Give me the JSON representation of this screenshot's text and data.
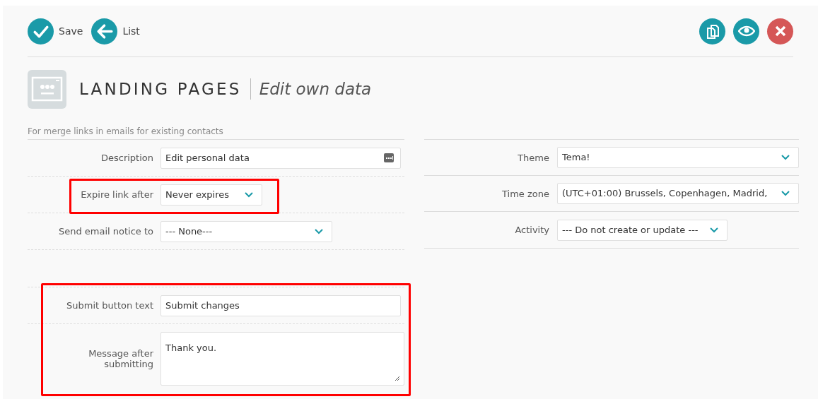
{
  "toolbar": {
    "left": [
      {
        "kind": "check",
        "label": "Save"
      },
      {
        "kind": "back",
        "label": "List"
      }
    ],
    "right": [
      {
        "kind": "copy",
        "color": "#1a9aa8"
      },
      {
        "kind": "view",
        "color": "#1a9aa8"
      },
      {
        "kind": "close",
        "color": "#d55757"
      }
    ]
  },
  "header": {
    "title": "LANDING PAGES",
    "subtitle": "Edit own data"
  },
  "section_note": "For merge links in emails for existing contacts",
  "left_groups": [
    {
      "highlighted": false,
      "rows": [
        {
          "label": "Description",
          "kind": "text",
          "value": "Edit personal data",
          "highlighted": false
        },
        {
          "label": "Expire link after",
          "kind": "select",
          "value": "Never expires",
          "highlighted": true
        },
        {
          "label": "Send email notice to",
          "kind": "select",
          "value": "--- None---",
          "highlighted": false
        }
      ]
    },
    {
      "highlighted": true,
      "rows": [
        {
          "label": "Submit button text",
          "kind": "input",
          "value": "Submit changes",
          "highlighted": false
        },
        {
          "label": "Message after submitting",
          "kind": "textarea",
          "value": "Thank you.",
          "highlighted": false
        }
      ]
    }
  ],
  "right_rows": [
    {
      "label": "Theme",
      "kind": "select",
      "value": "Tema!"
    },
    {
      "label": "Time zone",
      "kind": "select",
      "value": "(UTC+01:00) Brussels, Copenhagen, Madrid,"
    },
    {
      "label": "Activity",
      "kind": "select",
      "value": "--- Do not create or update ---"
    }
  ]
}
